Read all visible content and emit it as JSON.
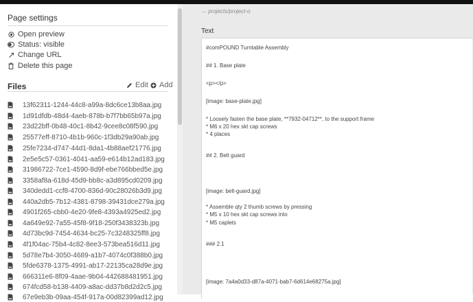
{
  "sidebar": {
    "settings_title": "Page settings",
    "settings_items": [
      {
        "icon": "eye-icon",
        "label": "Open preview"
      },
      {
        "icon": "toggle-icon",
        "label": "Status: visible"
      },
      {
        "icon": "link-icon",
        "label": "Change URL"
      },
      {
        "icon": "trash-icon",
        "label": "Delete this page"
      }
    ],
    "files_title": "Files",
    "edit_label": "Edit",
    "add_label": "Add",
    "files": [
      "13f62311-1244-44c8-a99a-8dc6ce13b8aa.jpg",
      "1d91dfdb-48d4-4aeb-878b-b7f7bb65b97a.jpg",
      "23d22bff-0b48-40c1-8b42-9cee8c08f590.jpg",
      "25577eff-8710-4b1b-960c-1f3db29a90ab.jpg",
      "25fe7234-d747-44d1-8da1-4b88aef21776.jpg",
      "2e5e5c57-0361-4041-aa59-e614b12ad183.jpg",
      "31986722-7ce1-4590-8d9f-ebe766bbed5e.jpg",
      "3358af8a-618d-45d9-bb8c-a3d895cd0209.jpg",
      "340dedd1-ccf8-4700-836d-90c28026b3d9.jpg",
      "440a2db5-7b12-4381-8798-39431dce279a.jpg",
      "4901f265-cbb0-4e20-9fe8-4393a4925ed2.jpg",
      "4a649e92-7a55-45f8-9f18-250f3438323b.jpg",
      "4d73bc9d-7454-4634-bc25-7c3248325ff8.jpg",
      "4f1f04ac-75b4-4c82-8ee3-573bea516d11.jpg",
      "5d78e7b4-3050-4689-a1b7-4074c0f388b0.jpg",
      "5fde6378-1375-4991-ab17-22135ca28d9e.jpg",
      "666311e6-8f09-4aae-9b04-442688481951.jpg",
      "674fcd58-b138-4409-a8ac-dd37b8d2d2c5.jpg",
      "67e9eb3b-09aa-454f-917a-00d82399ad12.jpg"
    ]
  },
  "main": {
    "breadcrumb": "→ projects/project-o",
    "text_label": "Text",
    "lines": [
      "#comPOUND Turntable Assembly",
      "## 1. Base plate",
      "<p></p>",
      "[image: base-plate.jpg]",
      "* Loosely fasten the base plate, **7932-04712**, to the support frame",
      "* M6 x 20 hex skt cap screws",
      "* 4 places",
      "## 2. Belt guard",
      "[image: belt-guard.jpg]",
      "* Assemble qty 2 thumb screws by pressing",
      "* M5 x 10 hex skt cap screws into",
      "* M5 caplets",
      "### 2.1",
      "[image: 7a4a0d33-d87a-4071-bab7-6d614e68275a.jpg]"
    ]
  }
}
